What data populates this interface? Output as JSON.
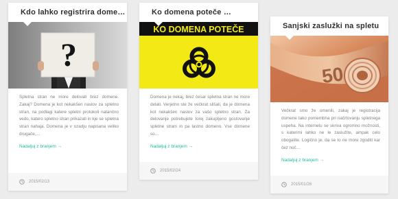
{
  "posts": [
    {
      "title": "Kdo lahko registrira domeno?",
      "image_label": "man-holding-question-mark-sign",
      "image_text": "?",
      "excerpt": "Spletna stran ne more delovati brez domene. Zakaj? Domena je kot nekakšen naslov za spletno stran, na podlagi katere spletni protokoli natančno vedo, katero spletno stran prikazati in kje se spletna stran nahaja. Domena je v ozadju napisana veliko drugače,…",
      "read_more": "Nadaljuj z branjem →",
      "date": "2015/02/13",
      "date_icon": "clock-icon"
    },
    {
      "title": "Ko domena poteče …",
      "image_label": "biohazard-warning-sign",
      "image_text": "KO DOMENA POTEČE",
      "excerpt": "Domena je nekaj, brez česar spletna stran ne more delati. Verjetno ste že večkrat slišali, da je domena kot nekakšen naslov za vašo spletno stran. Za delovanje potrebujete torej zakupljeno gostovanje spletne strani in pa lastno domeno. Vse domene so…",
      "read_more": "Nadaljuj z branjem →",
      "date": "2015/02/24",
      "date_icon": "clock-icon"
    },
    {
      "title": "Sanjski zaslužki na spletu",
      "image_label": "rolled-euro-banknotes",
      "image_text": "50",
      "excerpt": "Večkrat smo že omenili, zakaj je registracija domene tako pomembna pri načrtovanju spletnega uspeha. Na internetu se skriva ogromno možnosti, s katerimi lahko ne le zaslužite, ampak celo obogatite. Logično je, da se to ne more zgoditi kar čez noč…",
      "read_more": "Nadaljuj z branjem →",
      "date": "2015/01/26",
      "date_icon": "clock-icon"
    }
  ],
  "colors": {
    "accent": "#1bbc9b",
    "title": "#2f2f2f",
    "text": "#808080",
    "footer_bg": "#f6f6f6",
    "page_bg": "#ececec",
    "warning_yellow": "#f3ea15"
  }
}
